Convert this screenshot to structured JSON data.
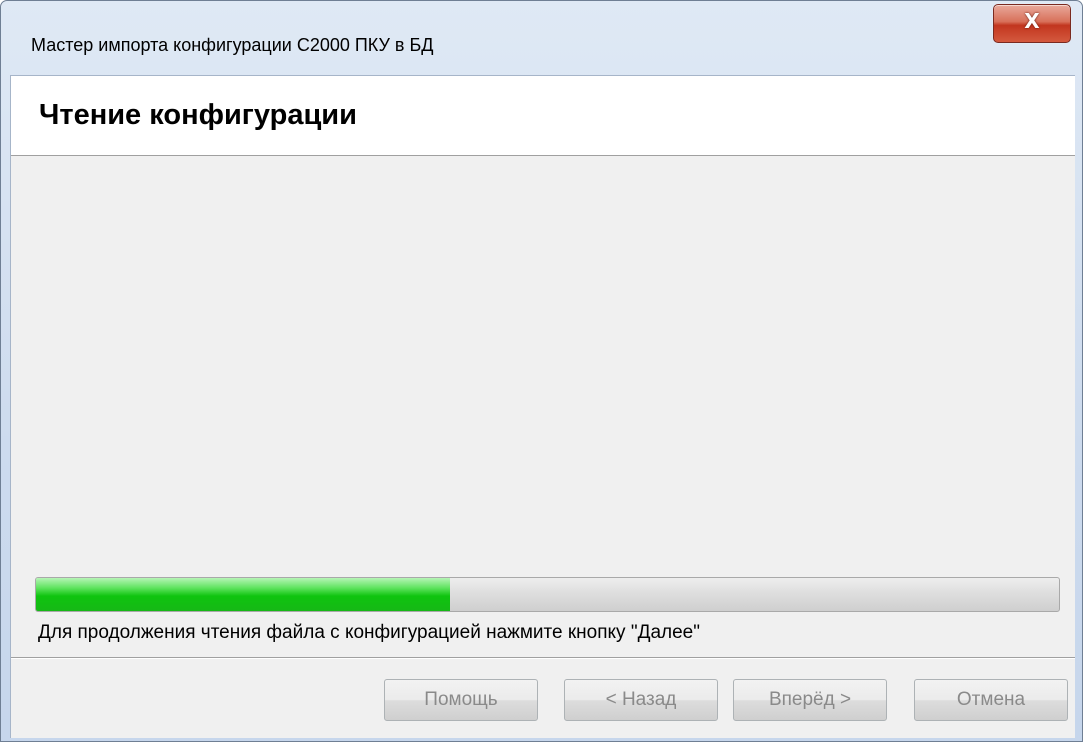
{
  "window": {
    "title": "Мастер импорта конфигурации С2000 ПКУ в БД",
    "close_label": "X"
  },
  "page": {
    "heading": "Чтение конфигурации"
  },
  "progress": {
    "value_fraction": 0.405,
    "track_color": "#d9d9d9",
    "fill_color": "#0fc40f"
  },
  "status": {
    "message": "Для продолжения чтения файла с конфигурацией нажмите кнопку \"Далее\""
  },
  "buttons": {
    "help": "Помощь",
    "back": "< Назад",
    "next": "Вперёд >",
    "cancel": "Отмена"
  }
}
